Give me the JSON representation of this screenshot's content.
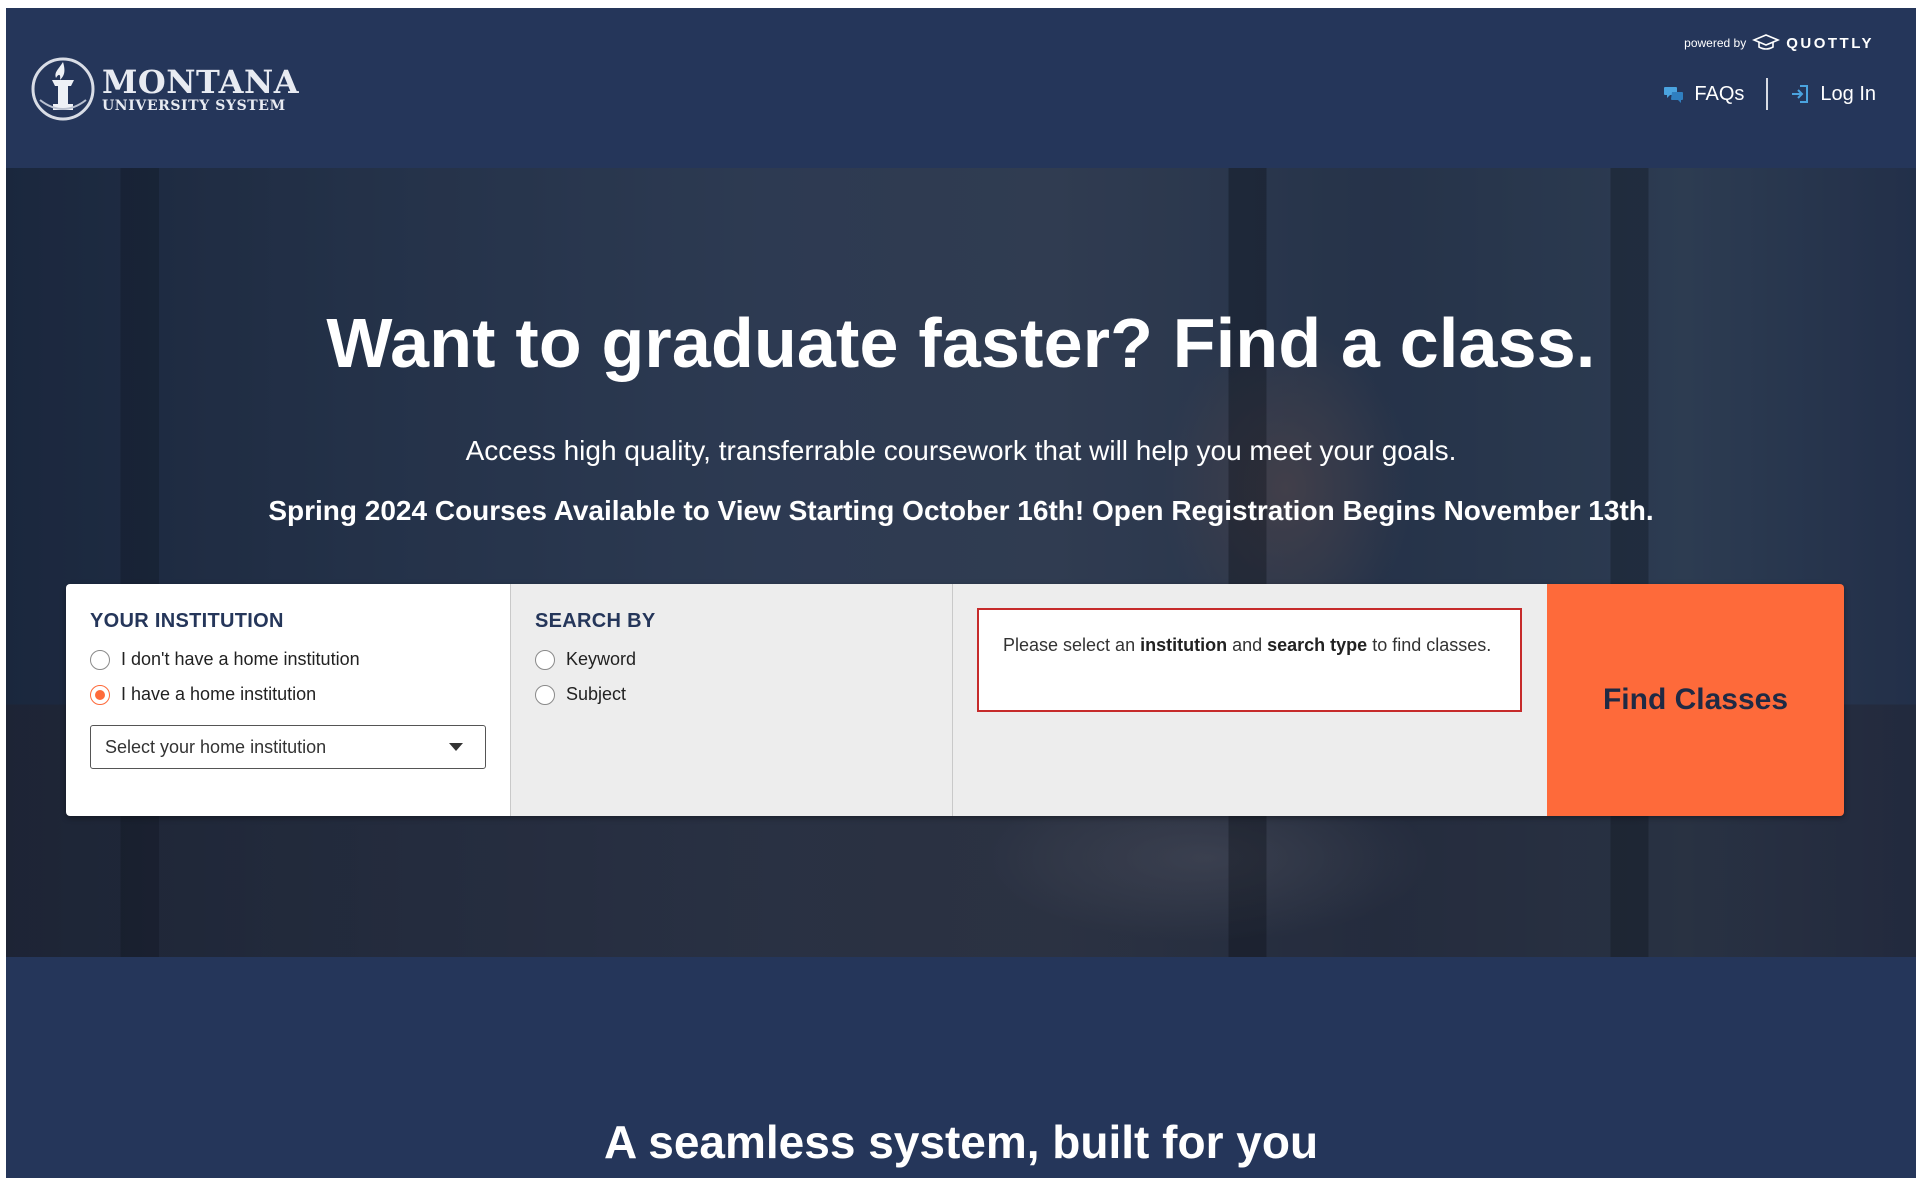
{
  "header": {
    "logo": {
      "line1": "MONTANA",
      "line2": "UNIVERSITY SYSTEM"
    },
    "powered_by": {
      "prefix": "powered by",
      "brand": "QUOTTLY"
    },
    "nav": {
      "faqs_label": "FAQs",
      "login_label": "Log In"
    }
  },
  "hero": {
    "title": "Want to graduate faster? Find a class.",
    "subtitle": "Access high quality, transferrable coursework that will help you meet your goals.",
    "notice": "Spring 2024 Courses Available to View Starting October 16th! Open Registration Begins November 13th."
  },
  "search_panel": {
    "institution": {
      "title": "YOUR INSTITUTION",
      "options": [
        {
          "label": "I don't have a home institution",
          "checked": false
        },
        {
          "label": "I have a home institution",
          "checked": true
        }
      ],
      "select_placeholder": "Select your home institution"
    },
    "search_by": {
      "title": "SEARCH BY",
      "options": [
        {
          "label": "Keyword",
          "checked": false
        },
        {
          "label": "Subject",
          "checked": false
        }
      ]
    },
    "message": {
      "part1": "Please select an ",
      "bold1": "institution",
      "part2": " and ",
      "bold2": "search type",
      "part3": " to find classes."
    },
    "find_button_label": "Find Classes"
  },
  "bottom": {
    "title": "A seamless system, built for you"
  },
  "colors": {
    "navy": "#25365a",
    "accent_orange": "#fe6a3a",
    "error_red": "#c62b2b"
  }
}
